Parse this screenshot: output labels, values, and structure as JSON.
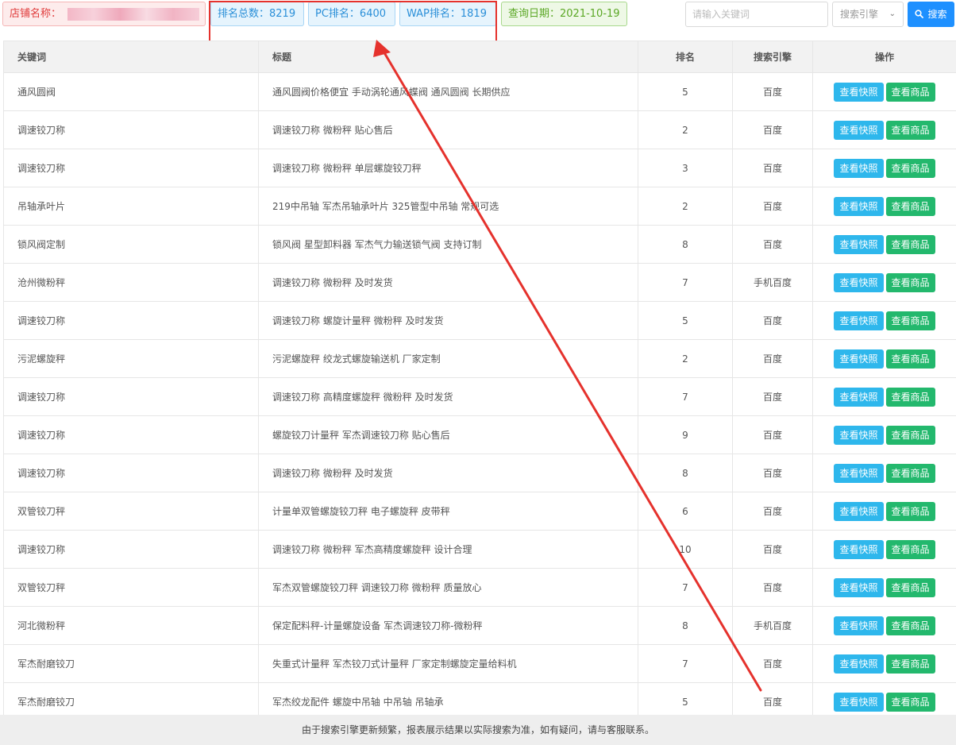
{
  "toolbar": {
    "shop_label": "店铺名称：",
    "total_rank": "排名总数：8219",
    "pc_rank": "PC排名：6400",
    "wap_rank": "WAP排名：1819",
    "query_date": "查询日期：2021-10-19",
    "search_placeholder": "请输入关键词",
    "engine_select": "搜索引擎",
    "search_button": "搜索"
  },
  "table": {
    "headers": {
      "keyword": "关键词",
      "title": "标题",
      "rank": "排名",
      "engine": "搜索引擎",
      "ops": "操作"
    },
    "rows": [
      {
        "keyword": "通风圆阀",
        "title": "通风圆阀价格便宜 手动涡轮通风蝶阀 通风圆阀 长期供应",
        "rank": "5",
        "engine": "百度"
      },
      {
        "keyword": "调速铰刀称",
        "title": "调速铰刀称 微粉秤 贴心售后",
        "rank": "2",
        "engine": "百度"
      },
      {
        "keyword": "调速铰刀称",
        "title": "调速铰刀称 微粉秤 单层螺旋铰刀秤",
        "rank": "3",
        "engine": "百度"
      },
      {
        "keyword": "吊轴承叶片",
        "title": "219中吊轴 军杰吊轴承叶片 325管型中吊轴 常规可选",
        "rank": "2",
        "engine": "百度"
      },
      {
        "keyword": "锁风阀定制",
        "title": "锁风阀 星型卸料器 军杰气力输送锁气阀 支持订制",
        "rank": "8",
        "engine": "百度"
      },
      {
        "keyword": "沧州微粉秤",
        "title": "调速铰刀称 微粉秤 及时发货",
        "rank": "7",
        "engine": "手机百度"
      },
      {
        "keyword": "调速铰刀称",
        "title": "调速铰刀称 螺旋计量秤 微粉秤 及时发货",
        "rank": "5",
        "engine": "百度"
      },
      {
        "keyword": "污泥螺旋秤",
        "title": "污泥螺旋秤 绞龙式螺旋输送机 厂家定制",
        "rank": "2",
        "engine": "百度"
      },
      {
        "keyword": "调速铰刀称",
        "title": "调速铰刀称 高精度螺旋秤 微粉秤 及时发货",
        "rank": "7",
        "engine": "百度"
      },
      {
        "keyword": "调速铰刀称",
        "title": "螺旋铰刀计量秤 军杰调速铰刀称 贴心售后",
        "rank": "9",
        "engine": "百度"
      },
      {
        "keyword": "调速铰刀称",
        "title": "调速铰刀称 微粉秤 及时发货",
        "rank": "8",
        "engine": "百度"
      },
      {
        "keyword": "双管铰刀秤",
        "title": "计量单双管螺旋铰刀秤 电子螺旋秤 皮带秤",
        "rank": "6",
        "engine": "百度"
      },
      {
        "keyword": "调速铰刀称",
        "title": "调速铰刀称 微粉秤 军杰高精度螺旋秤 设计合理",
        "rank": "10",
        "engine": "百度"
      },
      {
        "keyword": "双管铰刀秤",
        "title": "军杰双管螺旋铰刀秤 调速铰刀称 微粉秤 质量放心",
        "rank": "7",
        "engine": "百度"
      },
      {
        "keyword": "河北微粉秤",
        "title": "保定配料秤-计量螺旋设备 军杰调速铰刀称-微粉秤",
        "rank": "8",
        "engine": "手机百度"
      },
      {
        "keyword": "军杰耐磨铰刀",
        "title": "失重式计量秤 军杰铰刀式计量秤 厂家定制螺旋定量给料机",
        "rank": "7",
        "engine": "百度"
      },
      {
        "keyword": "军杰耐磨铰刀",
        "title": "军杰绞龙配件 螺旋中吊轴 中吊轴 吊轴承",
        "rank": "5",
        "engine": "百度"
      }
    ],
    "snapshot_label": "查看快照",
    "goods_label": "查看商品"
  },
  "footer": {
    "notice": "由于搜索引擎更新频繁，报表展示结果以实际搜索为准，如有疑问，请与客服联系。"
  },
  "colors": {
    "annotation": "#e5322d",
    "snapshot_btn": "#2eb7ec",
    "goods_btn": "#23b86d",
    "search_btn": "#1e90ff"
  }
}
